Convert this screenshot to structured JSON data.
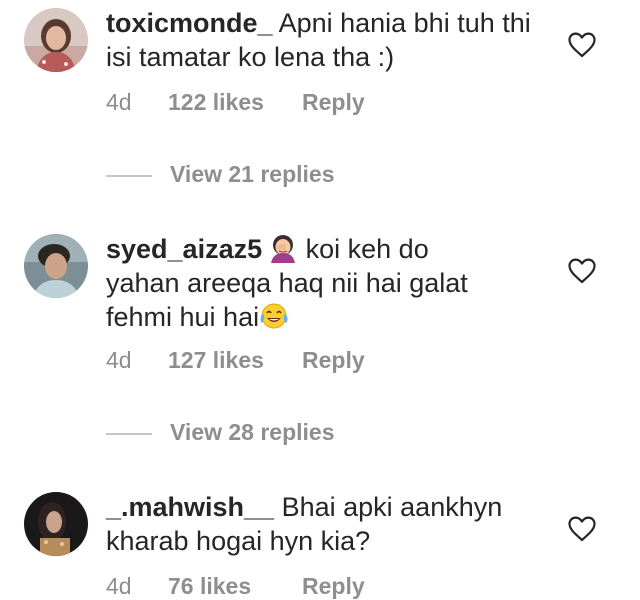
{
  "colors": {
    "text": "#262626",
    "secondary": "#8e8e8e",
    "divider": "#c7c7c7"
  },
  "comments": [
    {
      "username": "toxicmonde_",
      "text": "Apni hania bhi tuh thi isi tamatar ko lena tha :)",
      "time": "4d",
      "likes": "122 likes",
      "reply": "Reply",
      "view_replies": "View 21 replies",
      "avatar_icon": "avatar-photo-woman",
      "emoji": [],
      "heart_icon": "heart-outline-icon"
    },
    {
      "username": "syed_aizaz5",
      "text_before": "koi keh do yahan areeqa haq nii hai galat fehmi hui hai",
      "time": "4d",
      "likes": "127 likes",
      "reply": "Reply",
      "view_replies": "View 28 replies",
      "avatar_icon": "avatar-photo-man",
      "emoji": [
        "woman-facepalming-emoji",
        "face-with-tears-of-joy-emoji"
      ],
      "heart_icon": "heart-outline-icon"
    },
    {
      "username": "_.mahwish__",
      "text": "Bhai apki aankhyn kharab hogai hyn kia?",
      "time": "4d",
      "likes": "76 likes",
      "reply": "Reply",
      "avatar_icon": "avatar-photo-woman-dark",
      "emoji": [],
      "heart_icon": "heart-outline-icon"
    }
  ],
  "c2_parts": {
    "line1_text": "koi keh do",
    "line2": "yahan areeqa haq nii hai galat",
    "line3": "fehmi hui hai"
  }
}
